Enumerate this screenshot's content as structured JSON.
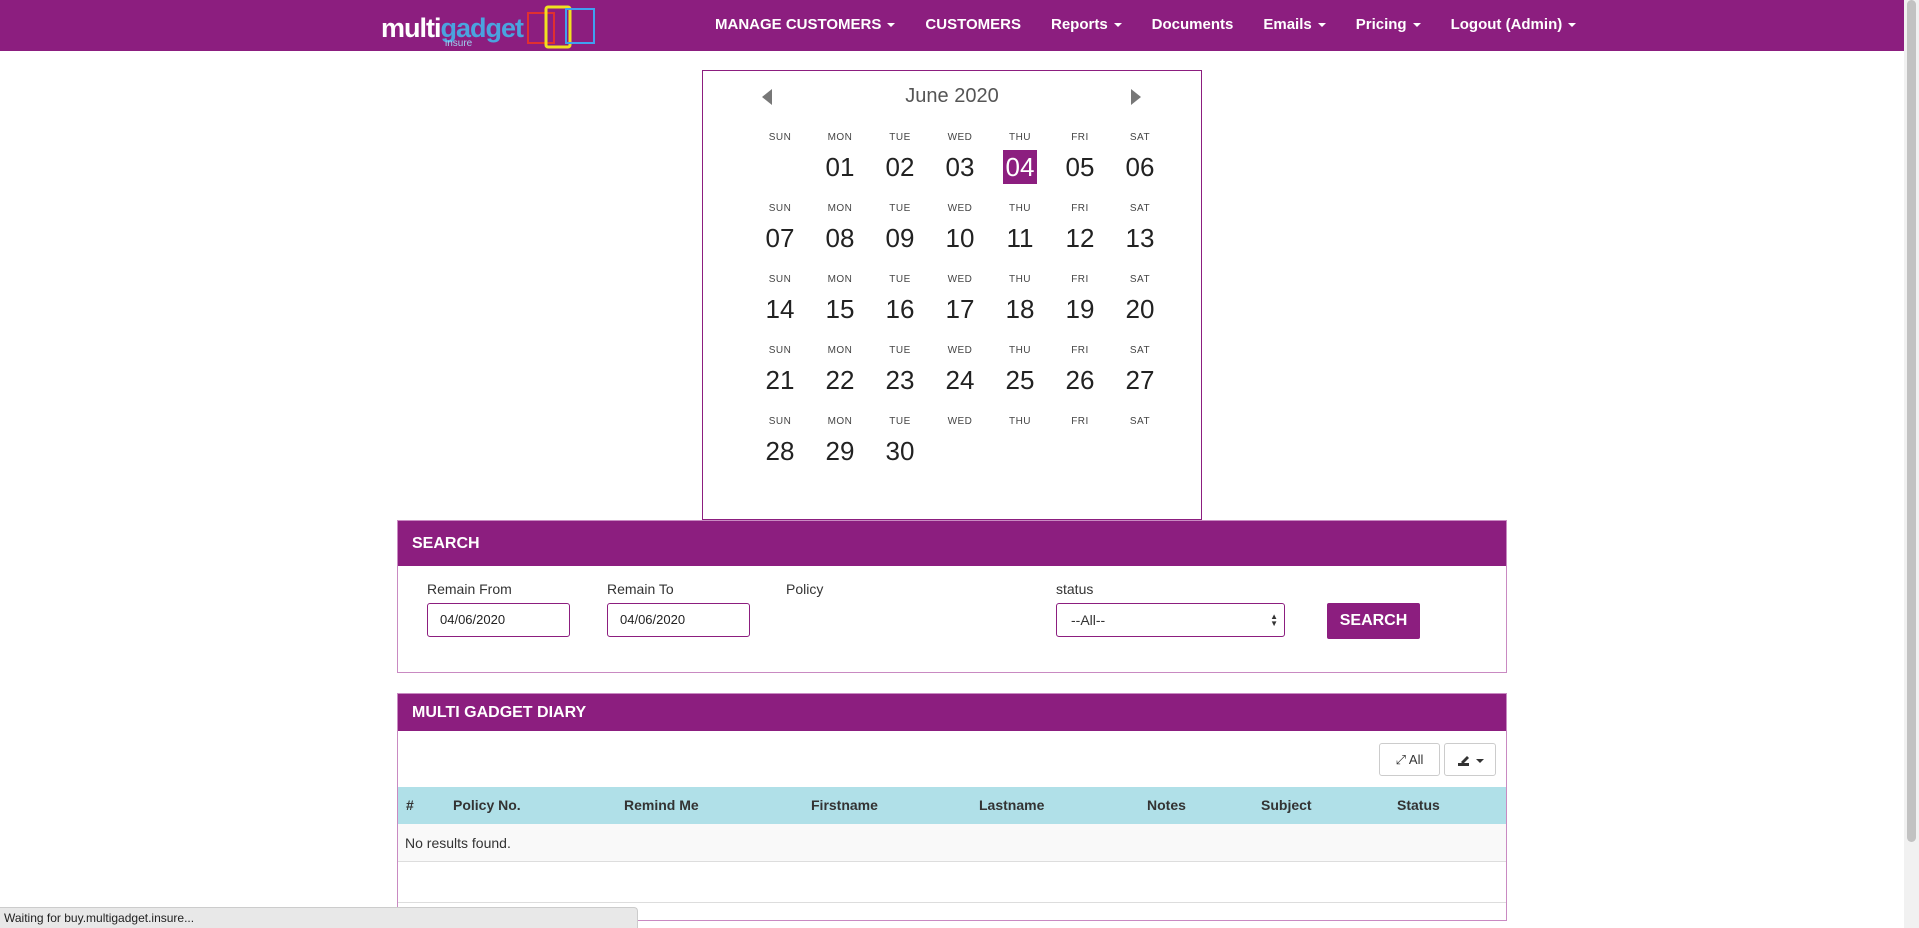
{
  "nav": {
    "logo_text_a": "multi",
    "logo_text_b": "gadget",
    "logo_sub": "insure",
    "items": [
      {
        "label": "MANAGE CUSTOMERS",
        "dropdown": true
      },
      {
        "label": "CUSTOMERS",
        "dropdown": false
      },
      {
        "label": "Reports",
        "dropdown": true
      },
      {
        "label": "Documents",
        "dropdown": false
      },
      {
        "label": "Emails",
        "dropdown": true
      },
      {
        "label": "Pricing",
        "dropdown": true
      },
      {
        "label": "Logout (Admin)",
        "dropdown": true
      }
    ]
  },
  "calendar": {
    "title": "June 2020",
    "selected": "04",
    "weeks": [
      [
        {
          "dow": "SUN",
          "day": ""
        },
        {
          "dow": "MON",
          "day": "01"
        },
        {
          "dow": "TUE",
          "day": "02"
        },
        {
          "dow": "WED",
          "day": "03"
        },
        {
          "dow": "THU",
          "day": "04"
        },
        {
          "dow": "FRI",
          "day": "05"
        },
        {
          "dow": "SAT",
          "day": "06"
        }
      ],
      [
        {
          "dow": "SUN",
          "day": "07"
        },
        {
          "dow": "MON",
          "day": "08"
        },
        {
          "dow": "TUE",
          "day": "09"
        },
        {
          "dow": "WED",
          "day": "10"
        },
        {
          "dow": "THU",
          "day": "11"
        },
        {
          "dow": "FRI",
          "day": "12"
        },
        {
          "dow": "SAT",
          "day": "13"
        }
      ],
      [
        {
          "dow": "SUN",
          "day": "14"
        },
        {
          "dow": "MON",
          "day": "15"
        },
        {
          "dow": "TUE",
          "day": "16"
        },
        {
          "dow": "WED",
          "day": "17"
        },
        {
          "dow": "THU",
          "day": "18"
        },
        {
          "dow": "FRI",
          "day": "19"
        },
        {
          "dow": "SAT",
          "day": "20"
        }
      ],
      [
        {
          "dow": "SUN",
          "day": "21"
        },
        {
          "dow": "MON",
          "day": "22"
        },
        {
          "dow": "TUE",
          "day": "23"
        },
        {
          "dow": "WED",
          "day": "24"
        },
        {
          "dow": "THU",
          "day": "25"
        },
        {
          "dow": "FRI",
          "day": "26"
        },
        {
          "dow": "SAT",
          "day": "27"
        }
      ],
      [
        {
          "dow": "SUN",
          "day": "28"
        },
        {
          "dow": "MON",
          "day": "29"
        },
        {
          "dow": "TUE",
          "day": "30"
        },
        {
          "dow": "WED",
          "day": ""
        },
        {
          "dow": "THU",
          "day": ""
        },
        {
          "dow": "FRI",
          "day": ""
        },
        {
          "dow": "SAT",
          "day": ""
        }
      ]
    ]
  },
  "search": {
    "heading": "SEARCH",
    "remain_from_label": "Remain From",
    "remain_from_value": "04/06/2020",
    "remain_to_label": "Remain To",
    "remain_to_value": "04/06/2020",
    "policy_label": "Policy",
    "status_label": "status",
    "status_value": "--All--",
    "button": "SEARCH"
  },
  "diary": {
    "heading": "MULTI GADGET DIARY",
    "all_button": "All",
    "columns": [
      "#",
      "Policy No.",
      "Remind Me",
      "Firstname",
      "Lastname",
      "Notes",
      "Subject",
      "Status"
    ],
    "empty_text": "No results found."
  },
  "statusbar": {
    "text": "Waiting for buy.multigadget.insure..."
  },
  "colors": {
    "brand": "#8c1e7f",
    "table_header": "#b0e0e8"
  }
}
